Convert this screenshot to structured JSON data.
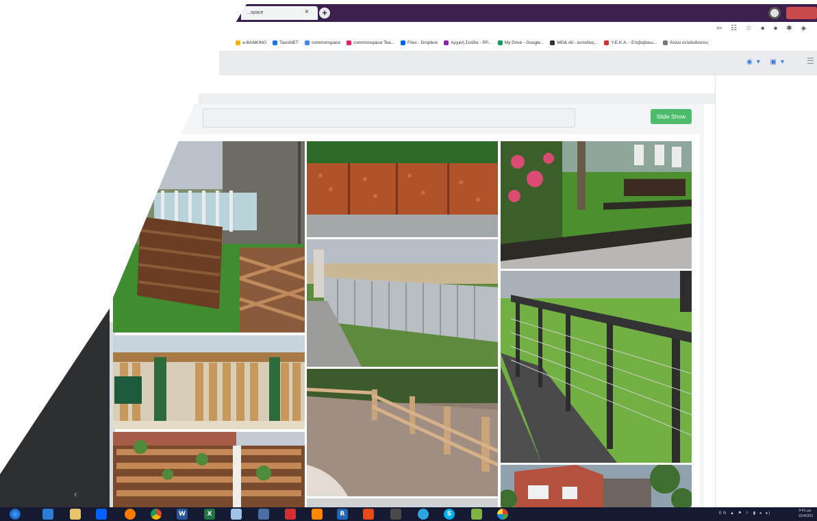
{
  "browser": {
    "tab_title": "...space",
    "tab_close": "×",
    "new_tab": "+",
    "bookmarks": [
      {
        "label": "e-BANKING",
        "color": "#f4b400"
      },
      {
        "label": "TaxisNET",
        "color": "#1a73e8"
      },
      {
        "label": "commonspace",
        "color": "#4285f4"
      },
      {
        "label": "commonspace Tea...",
        "color": "#e91e63"
      },
      {
        "label": "Files - Dropbox",
        "color": "#0061ff"
      },
      {
        "label": "Αρχική Σελίδα - PP...",
        "color": "#8e24aa"
      },
      {
        "label": "My Drive - Google...",
        "color": "#0f9d58"
      },
      {
        "label": "MO& All - αυτοδιας...",
        "color": "#333333"
      },
      {
        "label": "Υ.Ε.Κ.Α. - Επιβαβαιω...",
        "color": "#d32f2f"
      },
      {
        "label": "Άλλοι σελιδοδείκτες",
        "color": "#777777"
      }
    ],
    "toolbar_icons": "⇦ ☷ ☆ ● ● ✱ ◈"
  },
  "app": {
    "header_icons": "◉▾ ▣▾",
    "menu_icon": "☰",
    "search_placeholder": "",
    "slide_show_label": "Slide Show",
    "collapse_icon": "‹"
  },
  "gallery": {
    "photos": [
      {
        "name": "wicker-fence-playground"
      },
      {
        "name": "corten-steel-perforated-panels"
      },
      {
        "name": "ornamental-metal-edging-park"
      },
      {
        "name": "grey-curved-plank-wall"
      },
      {
        "name": "steel-cable-railing"
      },
      {
        "name": "wooden-slat-gate-green-posts"
      },
      {
        "name": "rustic-split-rail-fence"
      },
      {
        "name": "raised-wooden-planters"
      },
      {
        "name": "brick-house-hedge"
      }
    ]
  },
  "taskbar": {
    "tray_text": "EN ▲ ⚑ ⚐ ▮ ◂ ◂)",
    "clock_time": "3:41 μμ",
    "clock_date": "22/4/201"
  }
}
